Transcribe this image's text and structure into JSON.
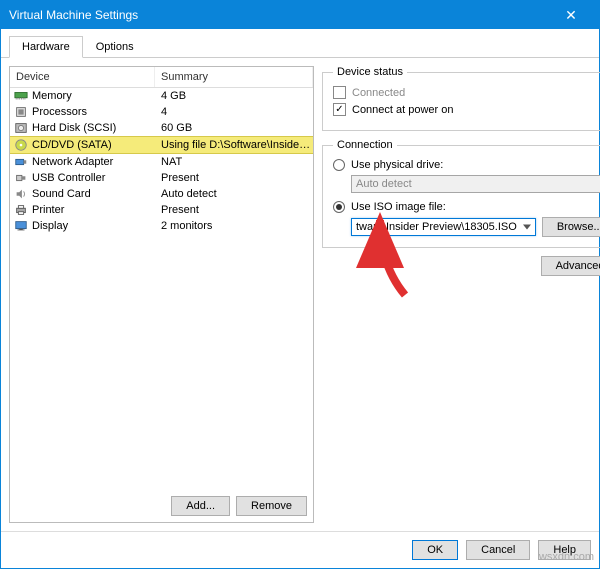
{
  "window": {
    "title": "Virtual Machine Settings"
  },
  "tabs": {
    "hardware": "Hardware",
    "options": "Options"
  },
  "device_table": {
    "headers": {
      "device": "Device",
      "summary": "Summary"
    },
    "rows": [
      {
        "device": "Memory",
        "summary": "4 GB",
        "icon": "memory-icon"
      },
      {
        "device": "Processors",
        "summary": "4",
        "icon": "cpu-icon"
      },
      {
        "device": "Hard Disk (SCSI)",
        "summary": "60 GB",
        "icon": "hdd-icon"
      },
      {
        "device": "CD/DVD (SATA)",
        "summary": "Using file D:\\Software\\Insider ...",
        "icon": "cd-icon",
        "selected": true
      },
      {
        "device": "Network Adapter",
        "summary": "NAT",
        "icon": "nic-icon"
      },
      {
        "device": "USB Controller",
        "summary": "Present",
        "icon": "usb-icon"
      },
      {
        "device": "Sound Card",
        "summary": "Auto detect",
        "icon": "sound-icon"
      },
      {
        "device": "Printer",
        "summary": "Present",
        "icon": "printer-icon"
      },
      {
        "device": "Display",
        "summary": "2 monitors",
        "icon": "display-icon"
      }
    ]
  },
  "buttons": {
    "add": "Add...",
    "remove": "Remove",
    "browse": "Browse...",
    "advanced": "Advanced...",
    "ok": "OK",
    "cancel": "Cancel",
    "help": "Help"
  },
  "device_status": {
    "legend": "Device status",
    "connected": "Connected",
    "connect_power_on": "Connect at power on"
  },
  "connection": {
    "legend": "Connection",
    "use_physical": "Use physical drive:",
    "physical_value": "Auto detect",
    "use_iso": "Use ISO image file:",
    "iso_value": "tware\\Insider Preview\\18305.ISO"
  },
  "watermark": "wsxdn.com"
}
